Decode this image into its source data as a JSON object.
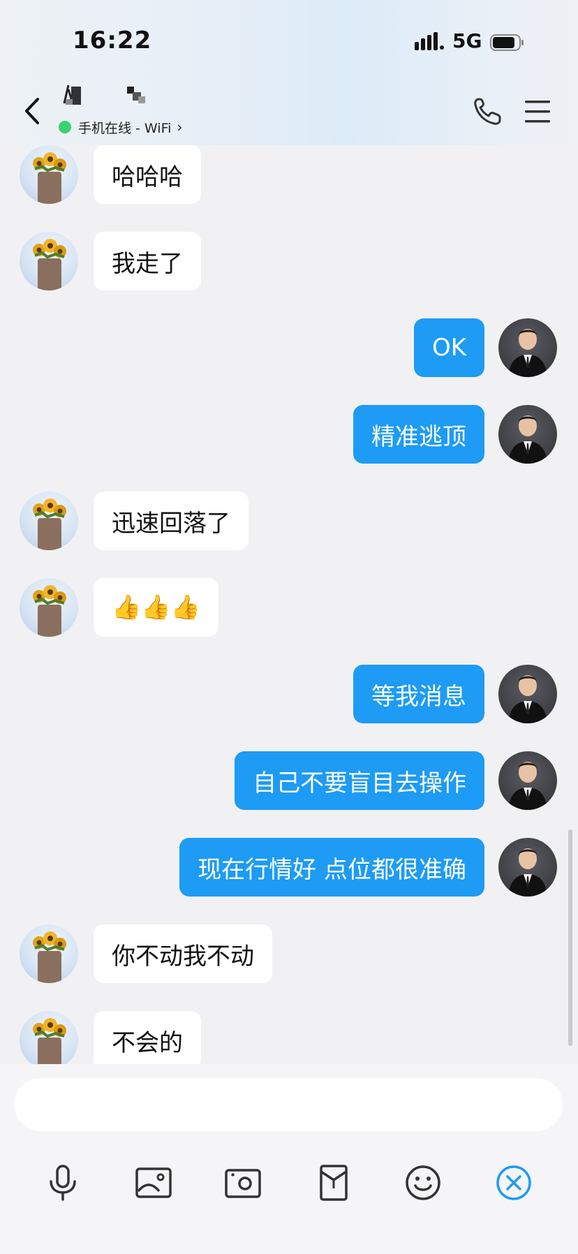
{
  "status_bar": {
    "time": "16:22",
    "network": "5G"
  },
  "header": {
    "contact_status": "手机在线 - WiFi",
    "icons": [
      "back-icon",
      "phone-icon",
      "menu-icon"
    ],
    "online_color": "#3ad170"
  },
  "messages": [
    {
      "side": "left",
      "text": "哈哈哈"
    },
    {
      "side": "left",
      "text": "我走了"
    },
    {
      "side": "right",
      "text": "OK"
    },
    {
      "side": "right",
      "text": "精准逃顶"
    },
    {
      "side": "left",
      "text": "迅速回落了"
    },
    {
      "side": "left",
      "text": "👍👍👍"
    },
    {
      "side": "right",
      "text": "等我消息"
    },
    {
      "side": "right",
      "text": "自己不要盲目去操作"
    },
    {
      "side": "right",
      "text": "现在行情好 点位都很准确"
    },
    {
      "side": "left",
      "text": "你不动我不动"
    },
    {
      "side": "left",
      "text": "不会的"
    }
  ],
  "composer": {
    "input_value": "",
    "tools": [
      "microphone-icon",
      "image-icon",
      "camera-icon",
      "red-packet-icon",
      "emoji-icon",
      "close-panel-icon"
    ]
  },
  "colors": {
    "sent_bubble": "#1d9bf5",
    "received_bubble": "#ffffff",
    "accent": "#1d9bf5"
  }
}
